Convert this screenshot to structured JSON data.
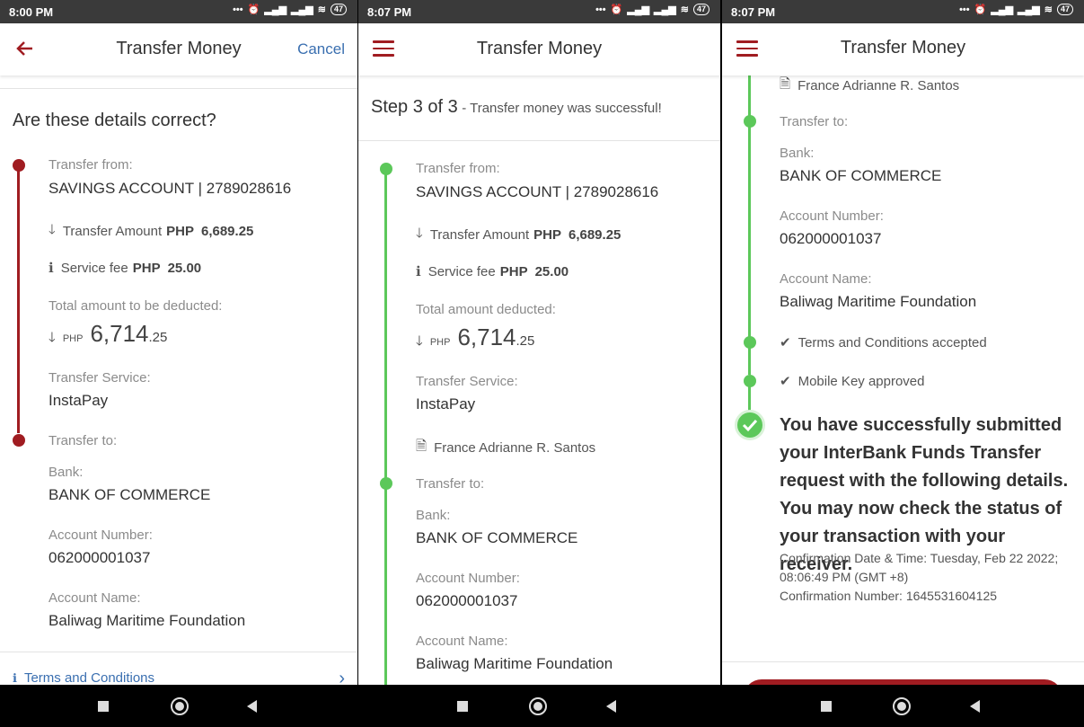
{
  "status": {
    "p1_time": "8:00 PM",
    "p2_time": "8:07 PM",
    "p3_time": "8:07 PM",
    "battery": "47"
  },
  "app": {
    "title": "Transfer Money",
    "cancel_label": "Cancel"
  },
  "review": {
    "heading": "Are these details correct?",
    "total_label": "Total amount to be deducted:",
    "terms_link": "Terms and Conditions"
  },
  "success_step": {
    "step": "Step 3 of 3",
    "step_note": "- Transfer money was successful!",
    "total_label": "Total amount deducted:"
  },
  "details": {
    "from_label": "Transfer from:",
    "from_value": "SAVINGS ACCOUNT | 2789028616",
    "amount_label": "Transfer Amount",
    "amount_currency": "PHP",
    "amount_value": "6,689.25",
    "fee_label": "Service fee",
    "fee_currency": "PHP",
    "fee_value": "25.00",
    "total_currency": "PHP",
    "total_int": "6,714",
    "total_dec": ".25",
    "service_label": "Transfer Service:",
    "service_value": "InstaPay",
    "recipient_note": "France Adrianne R. Santos",
    "to_label": "Transfer to:",
    "bank_label": "Bank:",
    "bank_value": "BANK OF COMMERCE",
    "acctno_label": "Account Number:",
    "acctno_value": "062000001037",
    "acctname_label": "Account Name:",
    "acctname_value": "Baliwag Maritime Foundation"
  },
  "confirmation": {
    "terms_accepted": "Terms and Conditions accepted",
    "mobile_key": "Mobile Key approved",
    "message": "You have successfully submitted your InterBank Funds Transfer request with the following details. You may now check the status of your transaction with your receiver.",
    "datetime_line1": "Confirmation Date & Time: Tuesday, Feb 22 2022;",
    "datetime_line2": "08:06:49 PM (GMT +8)",
    "number_line": "Confirmation Number: 1645531604125"
  },
  "colors": {
    "brand_red": "#a01c21",
    "success_green": "#5cc85a",
    "link_blue": "#3a6fb0"
  }
}
